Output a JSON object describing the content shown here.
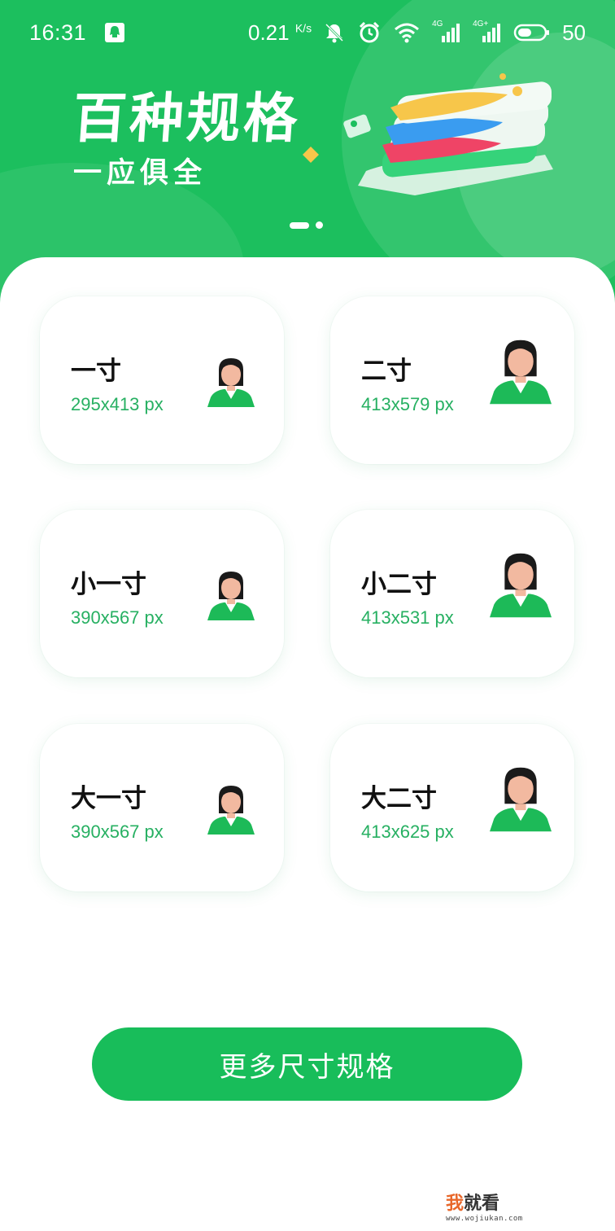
{
  "status_bar": {
    "time": "16:31",
    "net_speed": "0.21",
    "net_speed_unit": "K/s",
    "signal_1": "4G",
    "signal_2": "4G+",
    "battery": "50"
  },
  "banner": {
    "title": "百种规格",
    "subtitle": "一应俱全",
    "page_count": 2,
    "active_page": 1,
    "bg_color": "#1cbf5e"
  },
  "sizes": [
    {
      "name": "一寸",
      "dims": "295x413 px"
    },
    {
      "name": "二寸",
      "dims": "413x579 px"
    },
    {
      "name": "小一寸",
      "dims": "390x567 px"
    },
    {
      "name": "小二寸",
      "dims": "413x531 px"
    },
    {
      "name": "大一寸",
      "dims": "390x567 px"
    },
    {
      "name": "大二寸",
      "dims": "413x625 px"
    }
  ],
  "more_button": {
    "label": "更多尺寸规格",
    "color": "#18bd5a"
  },
  "watermark": {
    "accent": "我",
    "rest": "就看",
    "url": "www.wojiukan.com"
  },
  "colors": {
    "accent_text": "#27b062",
    "avatar_shirt": "#1dba58",
    "avatar_skin": "#f2b9a0",
    "avatar_hair": "#1a1a1a"
  }
}
